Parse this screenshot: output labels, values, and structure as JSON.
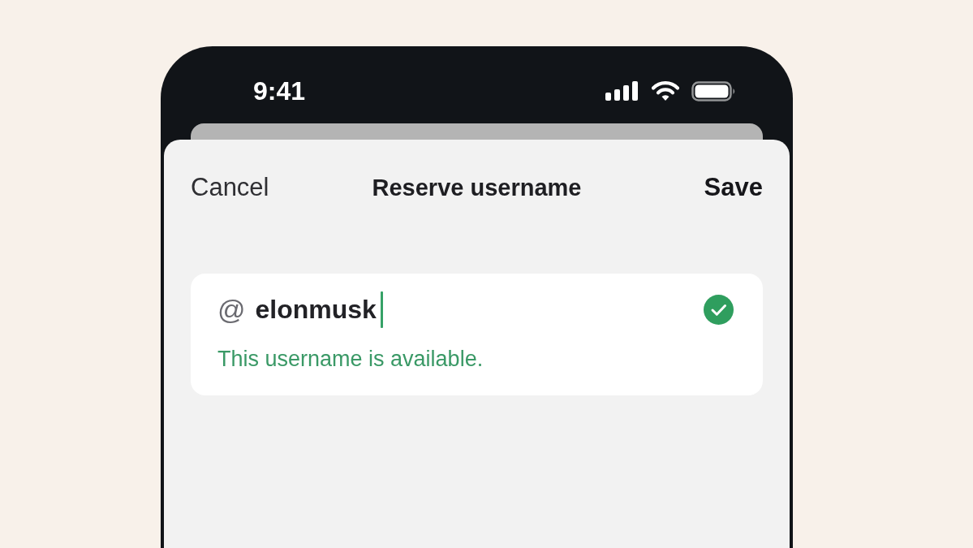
{
  "status_bar": {
    "time": "9:41"
  },
  "nav": {
    "cancel": "Cancel",
    "title": "Reserve username",
    "save": "Save"
  },
  "username_field": {
    "prefix": "@",
    "value": "elonmusk",
    "focused": true,
    "valid": true,
    "message": "This username is available."
  }
}
